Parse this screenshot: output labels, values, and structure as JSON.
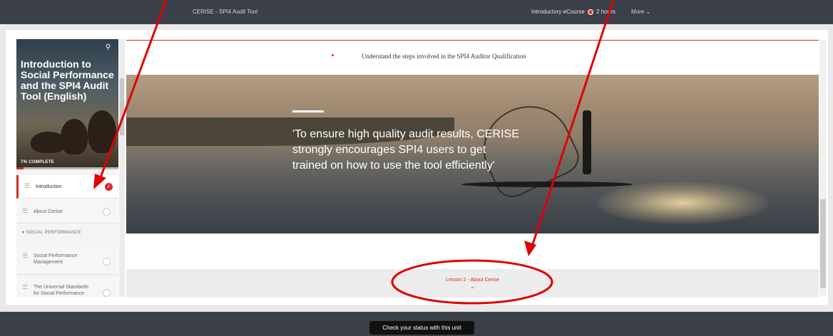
{
  "topbar": {
    "app_title": "CERISE - SPI4 Audit Tool",
    "course": "Introductory eCourse",
    "duration": "2 hours",
    "more": "More"
  },
  "sidebar": {
    "course_title": "Introduction to Social Performance and the SPI4 Audit Tool (English)",
    "progress_text": "7% COMPLETE",
    "progress_value": 0.07,
    "items": [
      {
        "label": "Introduction",
        "status": "complete"
      },
      {
        "label": "About Cerise",
        "status": "incomplete"
      },
      {
        "label": "Social Performance Management",
        "status": "incomplete"
      },
      {
        "label": "The Universal Standards for Social Performance",
        "status": "incomplete"
      }
    ],
    "section_label": "SOCIAL PERFORMANCE"
  },
  "main": {
    "objective": "Understand the steps involved in the SPI4 Auditor Qualification",
    "quote": "'To ensure high quality audit results, CERISE strongly encourages SPI4 users to get trained on how to use the tool efficiently'",
    "next_lesson": "Lesson 2 - About Cerise"
  },
  "footer": {
    "status_button": "Check your status with this unit"
  },
  "colors": {
    "accent": "#d42b2b",
    "topbar": "#3b3f47",
    "annotation": "#e00000"
  }
}
